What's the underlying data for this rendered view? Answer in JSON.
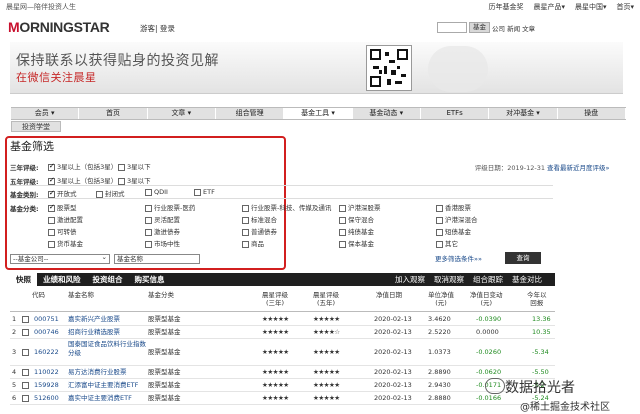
{
  "header": {
    "slogan": "晨星网—陪伴投资人生",
    "nav": [
      "历年基金奖",
      "晨星产品▾",
      "晨星中国▾",
      "首页▾"
    ],
    "logo_red": "M",
    "logo_rest": "ORNINGSTAR",
    "login": "游客| 登录",
    "search_button": "基金",
    "search_options": "公司 新闻 文章"
  },
  "banner": {
    "line1": "保持联系以获得贴身的投资见解",
    "line2": "在微信关注晨星"
  },
  "tabs": [
    {
      "label": "会员 ▾",
      "active": false
    },
    {
      "label": "首页",
      "active": false
    },
    {
      "label": "文章 ▾",
      "active": false
    },
    {
      "label": "组合管理",
      "active": false
    },
    {
      "label": "基金工具 ▾",
      "active": true
    },
    {
      "label": "基金动态 ▾",
      "active": false
    },
    {
      "label": "ETFs",
      "active": false
    },
    {
      "label": "对冲基金 ▾",
      "active": false
    },
    {
      "label": "操盘",
      "active": false
    }
  ],
  "tab_row2": "投资学堂",
  "screener": {
    "title": "基金筛选",
    "rating_date": "评级日期：2019-12-31",
    "rating_link": "查看最新近月度评级»",
    "rating3": {
      "label": "三年评级:",
      "opt1": "3星以上（包括3星）",
      "opt2": "3星以下"
    },
    "rating5": {
      "label": "五年评级:",
      "opt1": "3星以上（包括3星）",
      "opt2": "3星以下"
    },
    "fund_type": {
      "label": "基金类别:",
      "opts": [
        "开放式",
        "封闭式",
        "QDII",
        "ETF"
      ]
    },
    "category_label": "基金分类:",
    "categories": [
      [
        "股票型",
        "行业股票-医药",
        "行业股票-科技、传媒及通讯",
        "沪港深股票",
        "香港股票"
      ],
      [
        "激进配置",
        "灵活配置",
        "标准混合",
        "保守混合",
        "沪港深混合"
      ],
      [
        "可转债",
        "激进债券",
        "普通债券",
        "纯债基金",
        "短债基金"
      ],
      [
        "货币基金",
        "市场中性",
        "商品",
        "保本基金",
        "其它"
      ]
    ],
    "company_select": "--基金公司--",
    "name_placeholder": "基金名称",
    "more_link": "更多筛选条件»»",
    "query_button": "查询"
  },
  "subtabs": [
    "快照",
    "业绩和风险",
    "投资组合",
    "购买信息"
  ],
  "actions": [
    "加入观察",
    "取消观察",
    "组合跟踪",
    "基金对比"
  ],
  "table": {
    "headers": [
      "代码",
      "基金名称",
      "基金分类",
      "晨星评级\n(三年)",
      "晨星评级\n(五年)",
      "净值日期",
      "单位净值\n(元)",
      "净值日变动\n(元)",
      "今年以\n回报"
    ],
    "rows": [
      {
        "n": "1",
        "code": "000751",
        "name": "嘉实新兴产业股票",
        "cat": "股票型基金",
        "r3": "★★★★★",
        "r5": "★★★★★",
        "date": "2020-02-13",
        "nav": "3.4620",
        "chg": "-0.0390",
        "ytd": "13.36"
      },
      {
        "n": "2",
        "code": "000746",
        "name": "招商行业精选股票",
        "cat": "股票型基金",
        "r3": "★★★★★",
        "r5": "★★★★☆",
        "date": "2020-02-13",
        "nav": "2.5220",
        "chg": "0.0000",
        "ytd": "10.35"
      },
      {
        "n": "3",
        "code": "160222",
        "name": "国泰国证食品饮料行业指数分级",
        "cat": "股票型基金",
        "r3": "★★★★★",
        "r5": "★★★★★",
        "date": "2020-02-13",
        "nav": "1.0373",
        "chg": "-0.0260",
        "ytd": "-5.34"
      },
      {
        "n": "4",
        "code": "110022",
        "name": "易方达消费行业股票",
        "cat": "股票型基金",
        "r3": "★★★★★",
        "r5": "★★★★★",
        "date": "2020-02-13",
        "nav": "2.8890",
        "chg": "-0.0620",
        "ytd": "-5.50"
      },
      {
        "n": "5",
        "code": "159928",
        "name": "汇添富中证主要消费ETF",
        "cat": "股票型基金",
        "r3": "★★★★★",
        "r5": "★★★★★",
        "date": "2020-02-13",
        "nav": "2.9430",
        "chg": "-0.0171",
        "ytd": "-5.2"
      },
      {
        "n": "6",
        "code": "512600",
        "name": "嘉实中证主要消费ETF",
        "cat": "股票型基金",
        "r3": "★★★★★",
        "r5": "★★★★★",
        "date": "2020-02-13",
        "nav": "2.8880",
        "chg": "-0.0166",
        "ytd": "-5.24"
      }
    ]
  },
  "watermark": {
    "line1": "数据拾光者",
    "line2": "@稀土掘金技术社区"
  },
  "colors": {
    "accent_red": "#d21f1f",
    "link": "#1a4a8a",
    "negative": "#1f8a1f"
  }
}
